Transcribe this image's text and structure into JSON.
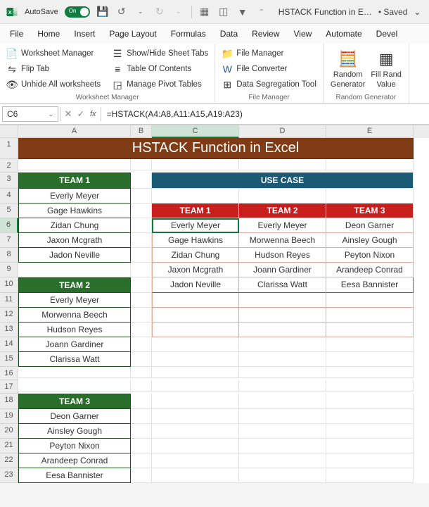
{
  "titlebar": {
    "autosave_label": "AutoSave",
    "toggle_label": "On",
    "doc_name": "HSTACK Function in E…",
    "saved": "• Saved",
    "saved_caret": "⌄"
  },
  "menutabs": [
    "File",
    "Home",
    "Insert",
    "Page Layout",
    "Formulas",
    "Data",
    "Review",
    "View",
    "Automate",
    "Devel"
  ],
  "ribbon": {
    "group1_title": "Worksheet Manager",
    "group1": {
      "col1": [
        "Worksheet Manager",
        "Flip Tab",
        "Unhide All worksheets"
      ],
      "col2": [
        "Show/Hide Sheet Tabs",
        "Table Of Contents",
        "Manage Pivot Tables"
      ]
    },
    "group2_title": "File Manager",
    "group2": [
      "File Manager",
      "File Converter",
      "Data Segregation Tool"
    ],
    "group3_title": "Random Generator",
    "group3_a": "Random",
    "group3_a2": "Generator",
    "group3_b": "Fill Rand",
    "group3_b2": "Value"
  },
  "formulabar": {
    "cell_ref": "C6",
    "fx": "fx",
    "formula": "=HSTACK(A4:A8,A11:A15,A19:A23)"
  },
  "sheet": {
    "cols": [
      "",
      "A",
      "B",
      "C",
      "D",
      "E"
    ],
    "title": "HSTACK Function in Excel",
    "usecase": "USE CASE",
    "team_headers": {
      "t1": "TEAM 1",
      "t2": "TEAM 2",
      "t3": "TEAM 3"
    },
    "team1": [
      "Everly Meyer",
      "Gage Hawkins",
      "Zidan Chung",
      "Jaxon Mcgrath",
      "Jadon Neville"
    ],
    "team2": [
      "Everly Meyer",
      "Morwenna Beech",
      "Hudson Reyes",
      "Joann Gardiner",
      "Clarissa Watt"
    ],
    "team3": [
      "Deon Garner",
      "Ainsley Gough",
      "Peyton Nixon",
      "Arandeep Conrad",
      "Eesa Bannister"
    ],
    "out_head": {
      "c": "TEAM 1",
      "d": "TEAM 2",
      "e": "TEAM 3"
    },
    "out_rows": [
      {
        "c": "Everly Meyer",
        "d": "Everly Meyer",
        "e": "Deon Garner"
      },
      {
        "c": "Gage Hawkins",
        "d": "Morwenna Beech",
        "e": "Ainsley Gough"
      },
      {
        "c": "Zidan Chung",
        "d": "Hudson Reyes",
        "e": "Peyton Nixon"
      },
      {
        "c": "Jaxon Mcgrath",
        "d": "Joann Gardiner",
        "e": "Arandeep Conrad"
      },
      {
        "c": "Jadon Neville",
        "d": "Clarissa Watt",
        "e": "Eesa Bannister"
      }
    ]
  }
}
